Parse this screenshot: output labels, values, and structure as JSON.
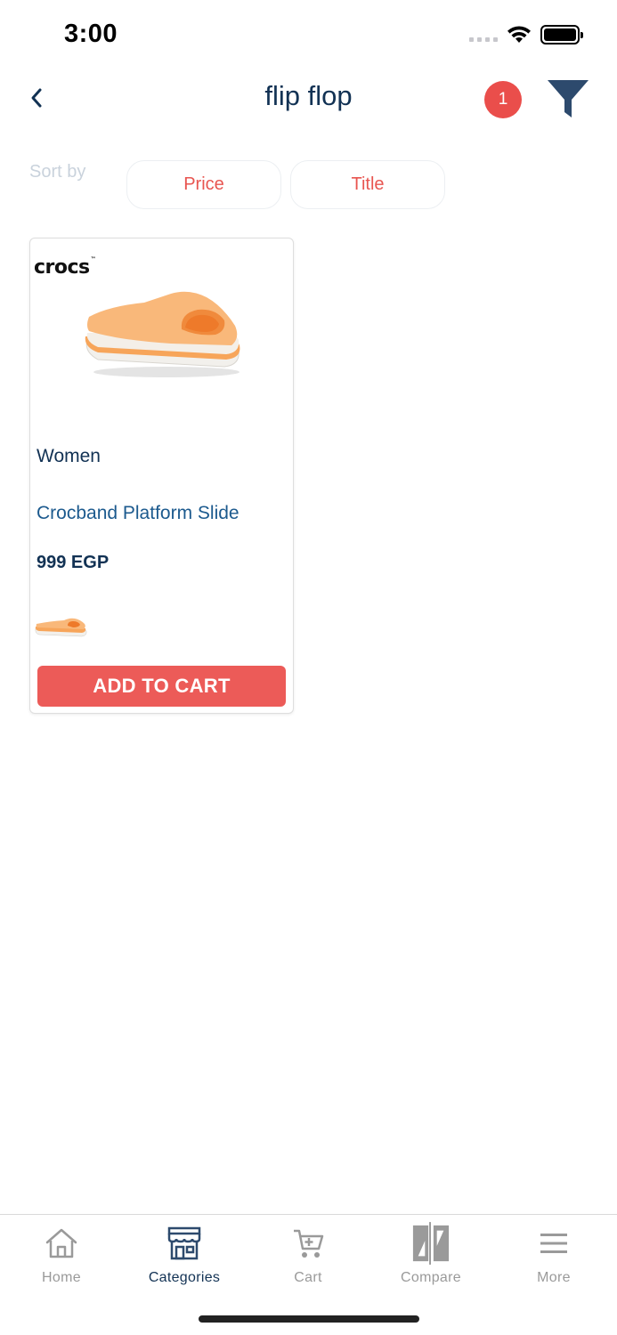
{
  "status_bar": {
    "time": "3:00"
  },
  "header": {
    "title": "flip flop",
    "filter_count": "1"
  },
  "sort": {
    "label": "Sort by",
    "options": [
      "Price",
      "Title"
    ]
  },
  "product": {
    "brand": "crocs",
    "category": "Women",
    "name": "Crocband Platform Slide",
    "price": "999 EGP",
    "add_to_cart_label": "ADD TO CART"
  },
  "tabs": [
    {
      "label": "Home",
      "icon": "home-icon",
      "active": false
    },
    {
      "label": "Categories",
      "icon": "store-icon",
      "active": true
    },
    {
      "label": "Cart",
      "icon": "cart-icon",
      "active": false
    },
    {
      "label": "Compare",
      "icon": "compare-icon",
      "active": false
    },
    {
      "label": "More",
      "icon": "menu-icon",
      "active": false
    }
  ],
  "colors": {
    "accent": "#ec5b58",
    "navy": "#123254",
    "link_blue": "#1c5a8e",
    "product_orange": "#f9b87a"
  }
}
